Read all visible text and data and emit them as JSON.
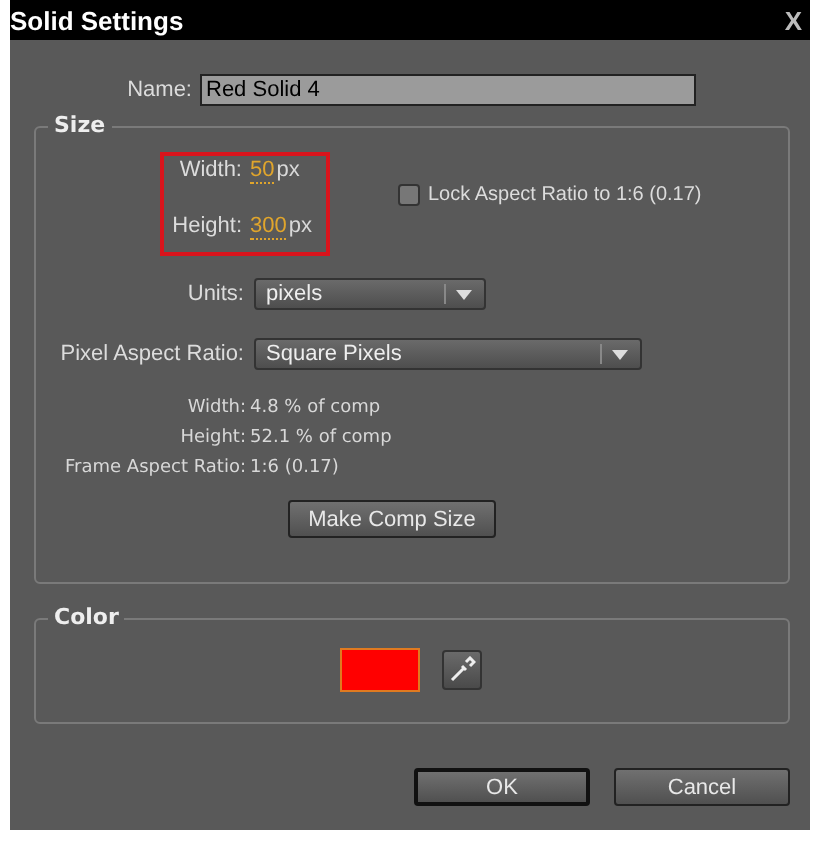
{
  "window": {
    "title": "Solid Settings",
    "close": "X"
  },
  "name": {
    "label": "Name:",
    "value": "Red Solid 4"
  },
  "size": {
    "title": "Size",
    "width": {
      "label": "Width:",
      "value": "50",
      "unit": "px"
    },
    "height": {
      "label": "Height:",
      "value": "300",
      "unit": "px"
    },
    "lock": {
      "label": "Lock Aspect Ratio to 1:6 (0.17)",
      "checked": false
    },
    "units": {
      "label": "Units:",
      "value": "pixels"
    },
    "pixel_aspect": {
      "label": "Pixel Aspect Ratio:",
      "value": "Square Pixels"
    },
    "info": [
      {
        "label": "Width:",
        "value": "4.8 % of comp"
      },
      {
        "label": "Height:",
        "value": "52.1 % of comp"
      },
      {
        "label": "Frame Aspect Ratio:",
        "value": "1:6 (0.17)"
      }
    ],
    "button": "Make Comp Size"
  },
  "color": {
    "title": "Color",
    "swatch": {
      "color": "#ff0000"
    }
  },
  "buttons": [
    {
      "label": "OK",
      "default": true
    },
    {
      "label": "Cancel",
      "default": false
    }
  ]
}
